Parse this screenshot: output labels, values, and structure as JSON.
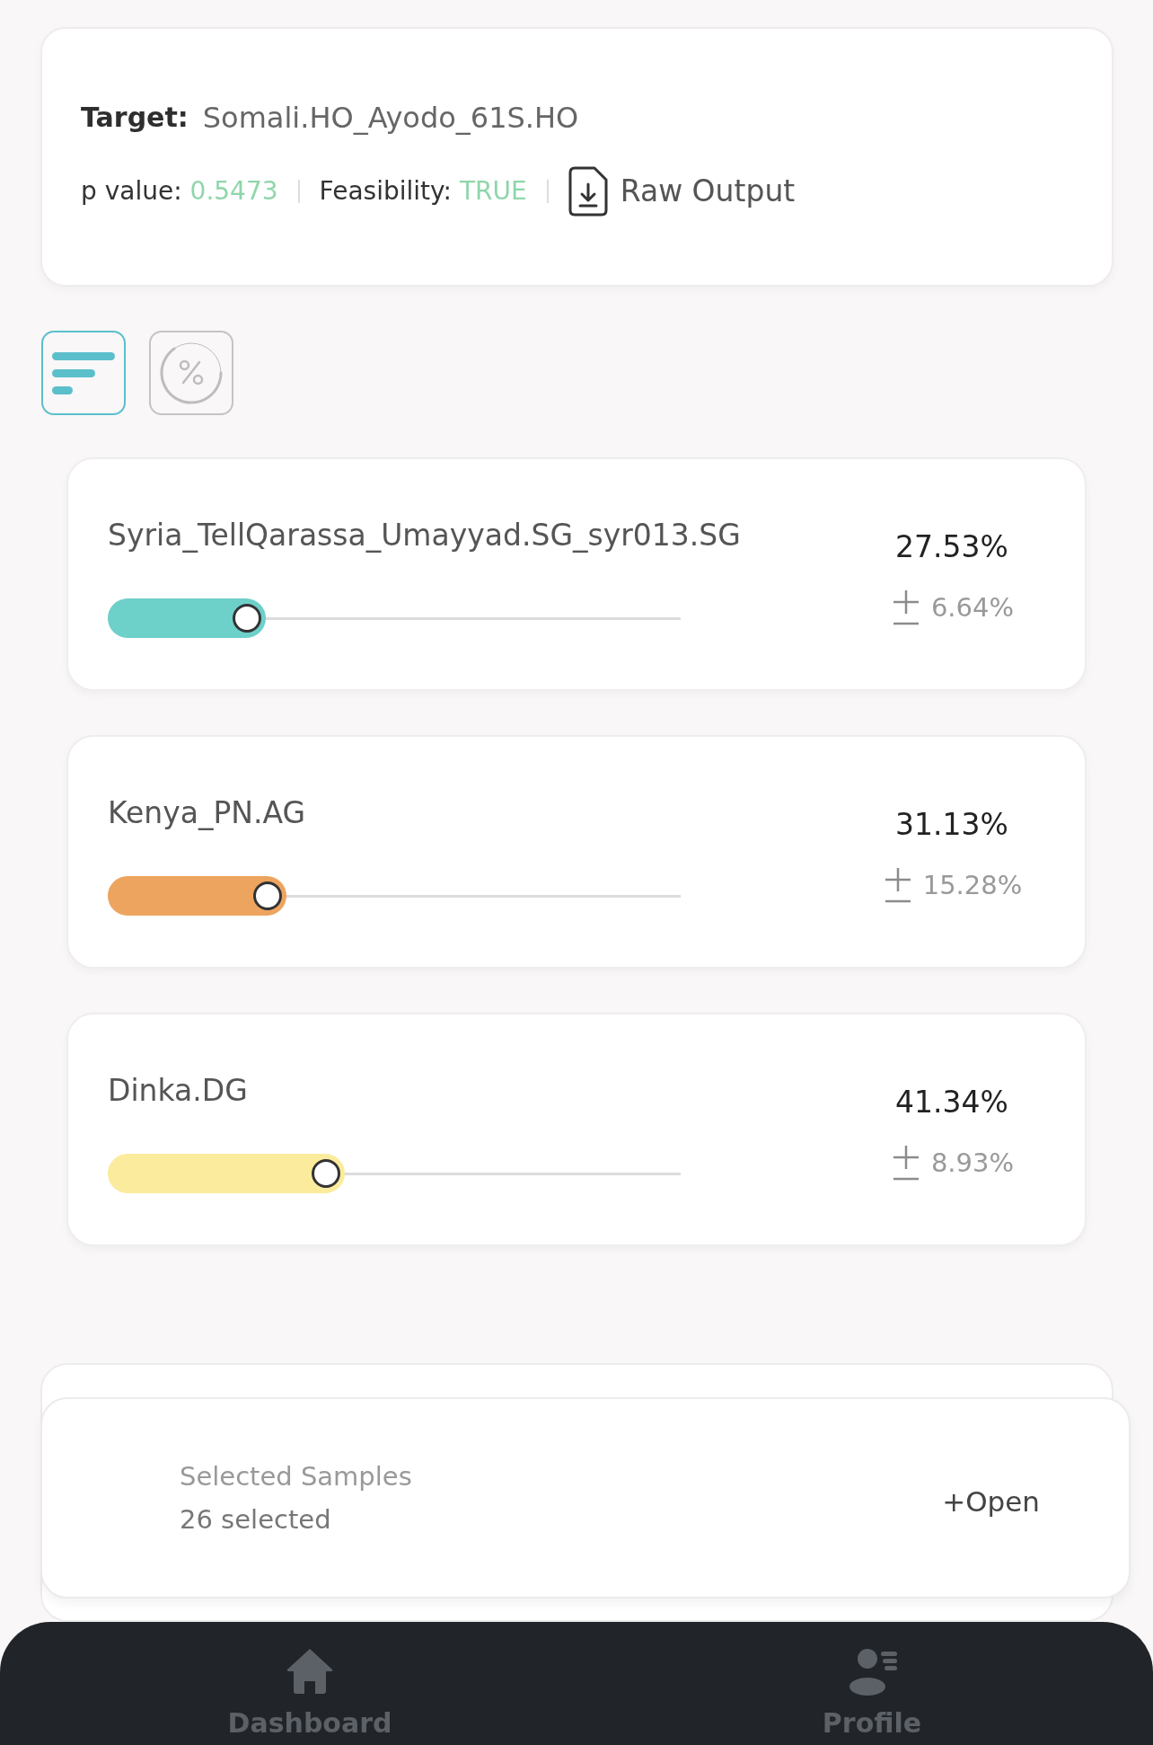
{
  "summary": {
    "target_label": "Target:",
    "target": "Somali.HO_Ayodo_61S.HO",
    "p_value_label": "p value:",
    "p_value": "0.5473",
    "feasibility_label": "Feasibility:",
    "feasibility": "TRUE",
    "raw_output": "Raw Output"
  },
  "view_toggles": [
    {
      "kind": "bars",
      "selected": true
    },
    {
      "kind": "percent",
      "selected": false
    }
  ],
  "sources": [
    {
      "name": "Syria_TellQarassa_Umayyad.SG_syr013.SG",
      "percent": "27.53%",
      "error": "6.64%",
      "level": 0.2753,
      "color": "#6dd0c9"
    },
    {
      "name": "Kenya_PN.AG",
      "percent": "31.13%",
      "error": "15.28%",
      "level": 0.3113,
      "color": "#eda45f"
    },
    {
      "name": "Dinka.DG",
      "percent": "41.34%",
      "error": "8.93%",
      "level": 0.4134,
      "color": "#fbeb9d"
    }
  ],
  "selected_samples": {
    "title": "Selected Samples",
    "count": "26 selected",
    "action": "+Open"
  },
  "nav": [
    {
      "kind": "home",
      "label": "Dashboard"
    },
    {
      "kind": "profile",
      "label": "Profile"
    }
  ]
}
